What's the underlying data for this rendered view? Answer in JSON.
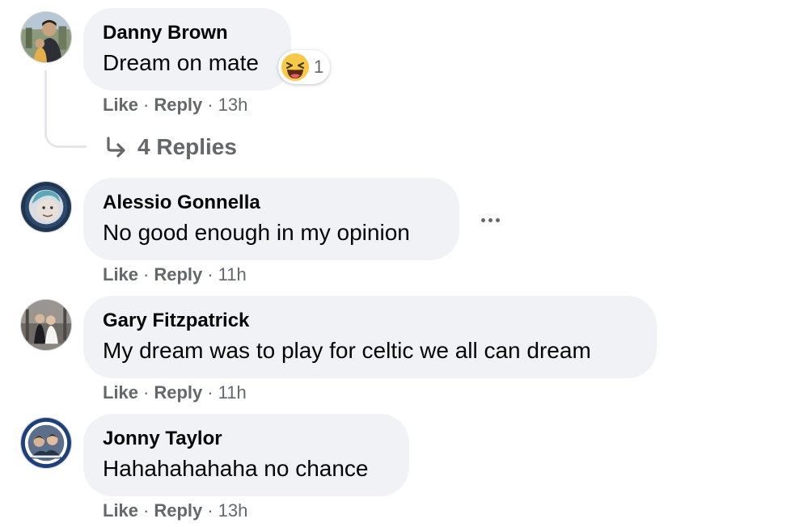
{
  "comments": [
    {
      "author": "Danny Brown",
      "text": "Dream on mate",
      "actions": {
        "like": "Like",
        "reply": "Reply",
        "time": "13h"
      },
      "reaction": {
        "icon": "laughing-emoji-icon",
        "count": "1"
      },
      "replies_label": "4 Replies"
    },
    {
      "author": "Alessio Gonnella",
      "text": "No good enough in my opinion",
      "actions": {
        "like": "Like",
        "reply": "Reply",
        "time": "11h"
      }
    },
    {
      "author": "Gary Fitzpatrick",
      "text": "My dream was to play for celtic we all can dream",
      "actions": {
        "like": "Like",
        "reply": "Reply",
        "time": "11h"
      }
    },
    {
      "author": "Jonny Taylor",
      "text": "Hahahahahaha no chance",
      "actions": {
        "like": "Like",
        "reply": "Reply",
        "time": "13h"
      }
    }
  ],
  "separator": "·",
  "colors": {
    "bubble": "#f0f2f5",
    "secondary_text": "#65676b",
    "primary_text": "#050505",
    "reaction_face": "#f7c948"
  }
}
